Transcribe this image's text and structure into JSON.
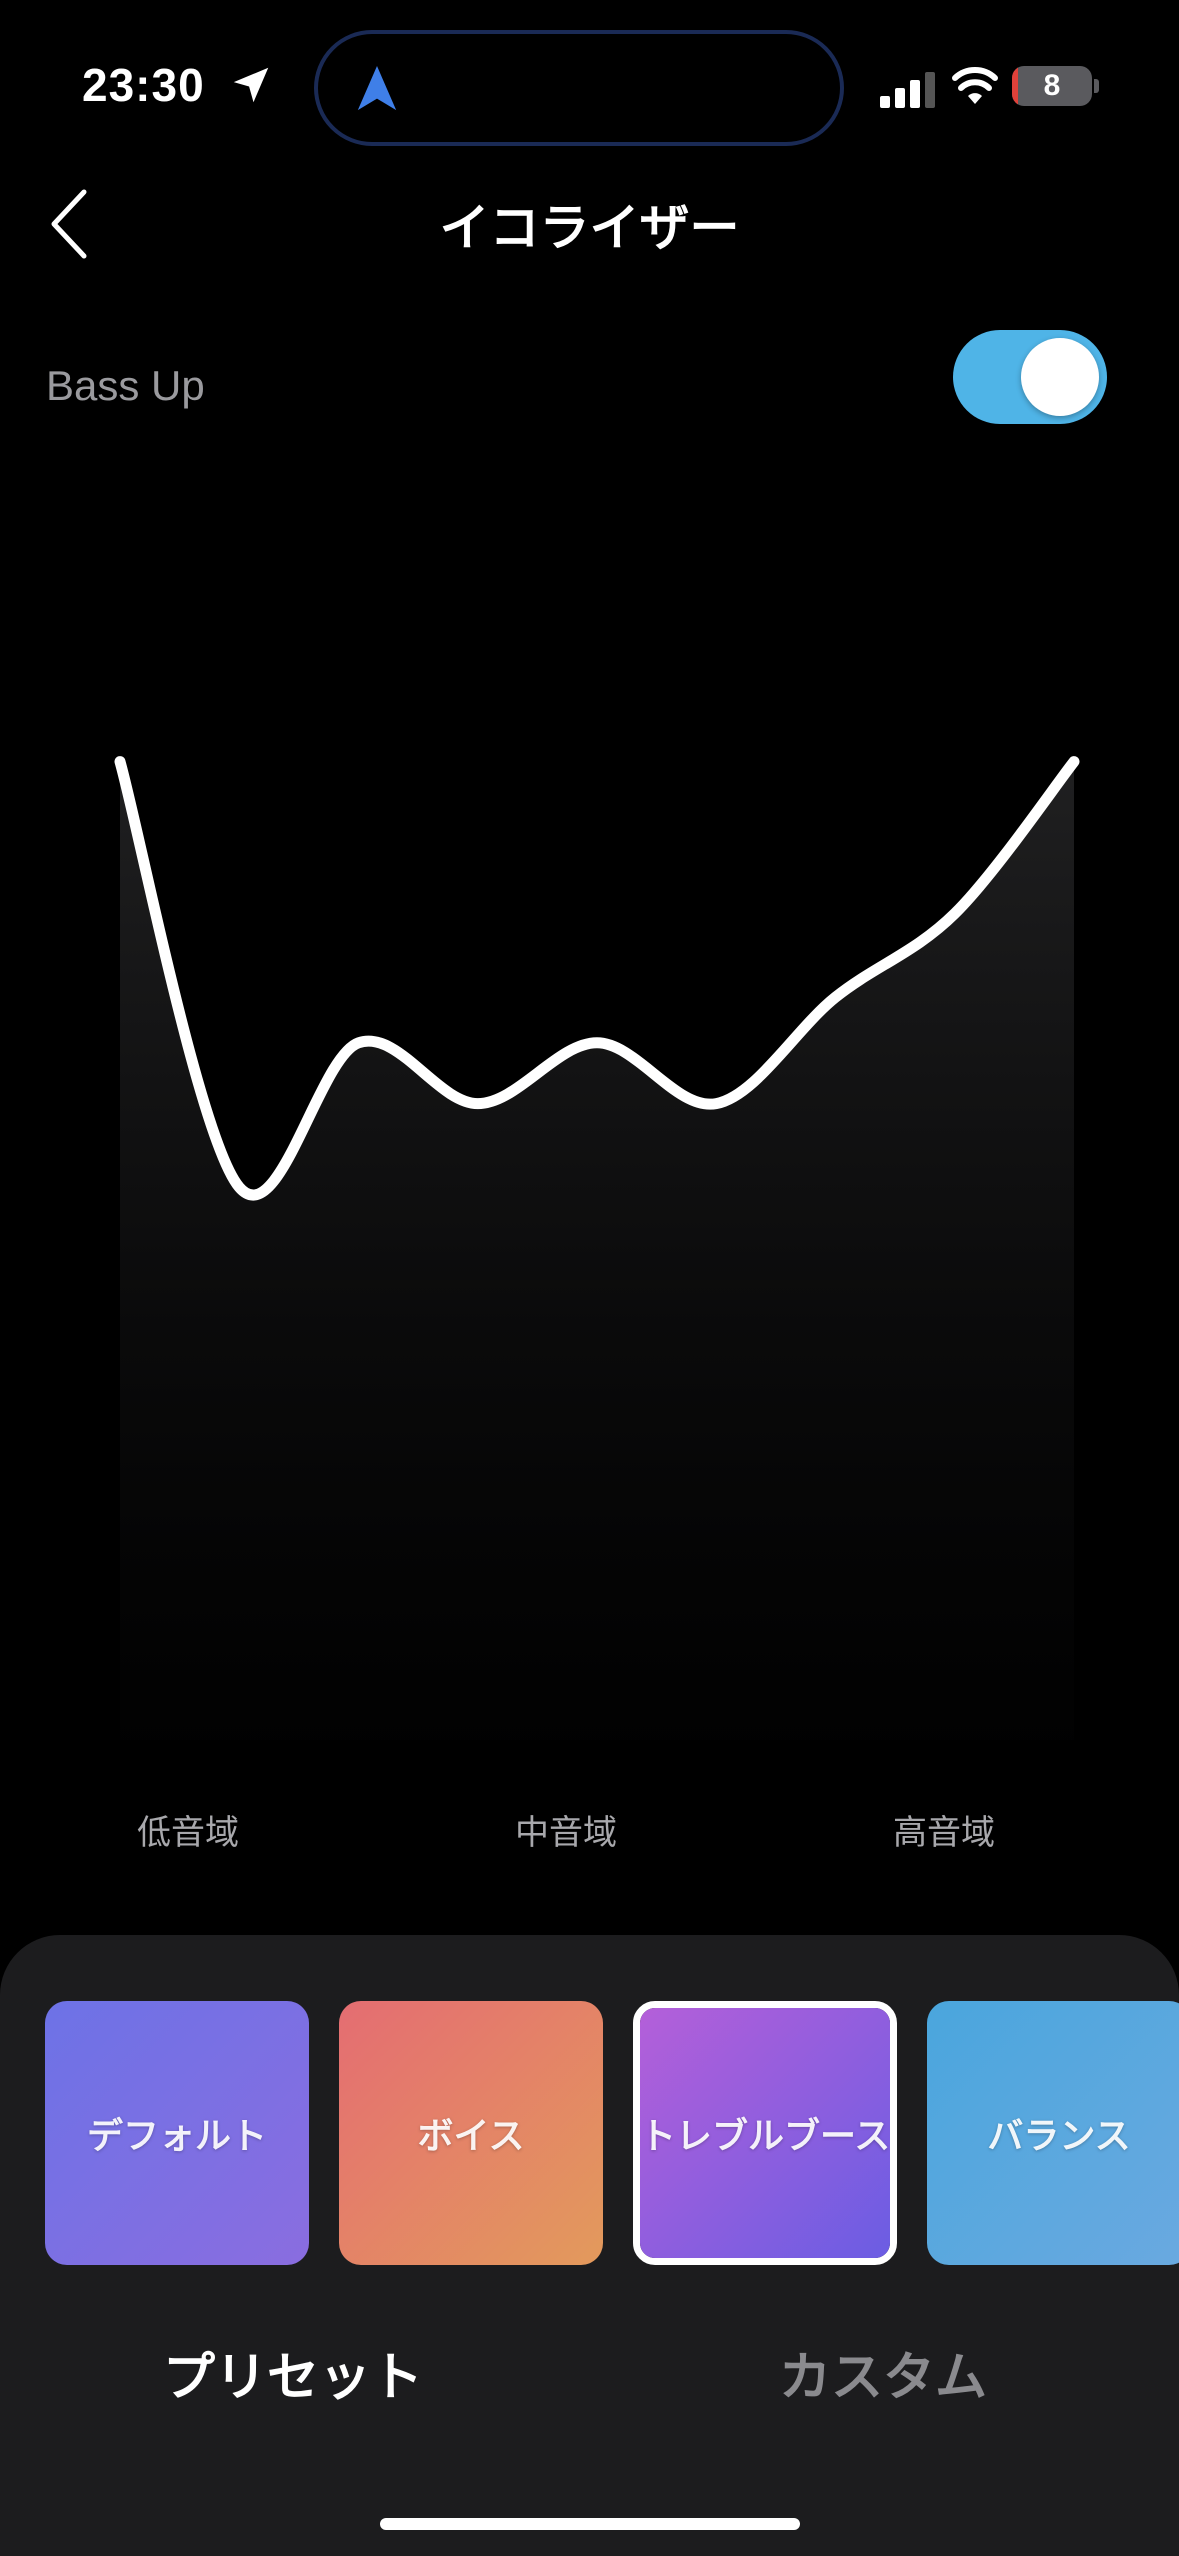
{
  "status_bar": {
    "time": "23:30",
    "battery_percent": "8",
    "battery_level": 0.08,
    "icons": [
      "location-arrow-icon",
      "navigation-icon",
      "cellular-signal-icon",
      "wifi-icon",
      "battery-icon"
    ]
  },
  "header": {
    "title": "イコライザー",
    "back_icon": "chevron-left-icon"
  },
  "bass_up": {
    "label": "Bass Up",
    "enabled": true,
    "accent_color": "#4fb4e7"
  },
  "equalizer": {
    "band_labels": [
      "低音域",
      "中音域",
      "高音域"
    ],
    "band_count": 9,
    "levels": [
      0.84,
      0.28,
      0.47,
      0.39,
      0.47,
      0.39,
      0.53,
      0.64,
      0.84
    ]
  },
  "presets": [
    {
      "label": "デフォルト",
      "selected": false,
      "colors": [
        "#6d72e6",
        "#8a6de0"
      ]
    },
    {
      "label": "ボイス",
      "selected": false,
      "colors": [
        "#e46d72",
        "#e39a5c"
      ]
    },
    {
      "label": "トレブルブースト",
      "selected": true,
      "colors": [
        "#b45fd9",
        "#6b5de3"
      ]
    },
    {
      "label": "バランス",
      "selected": false,
      "colors": [
        "#4aa6dd",
        "#6aa9e0"
      ]
    }
  ],
  "tabs": {
    "preset_label": "プリセット",
    "custom_label": "カスタム",
    "active": "preset"
  }
}
